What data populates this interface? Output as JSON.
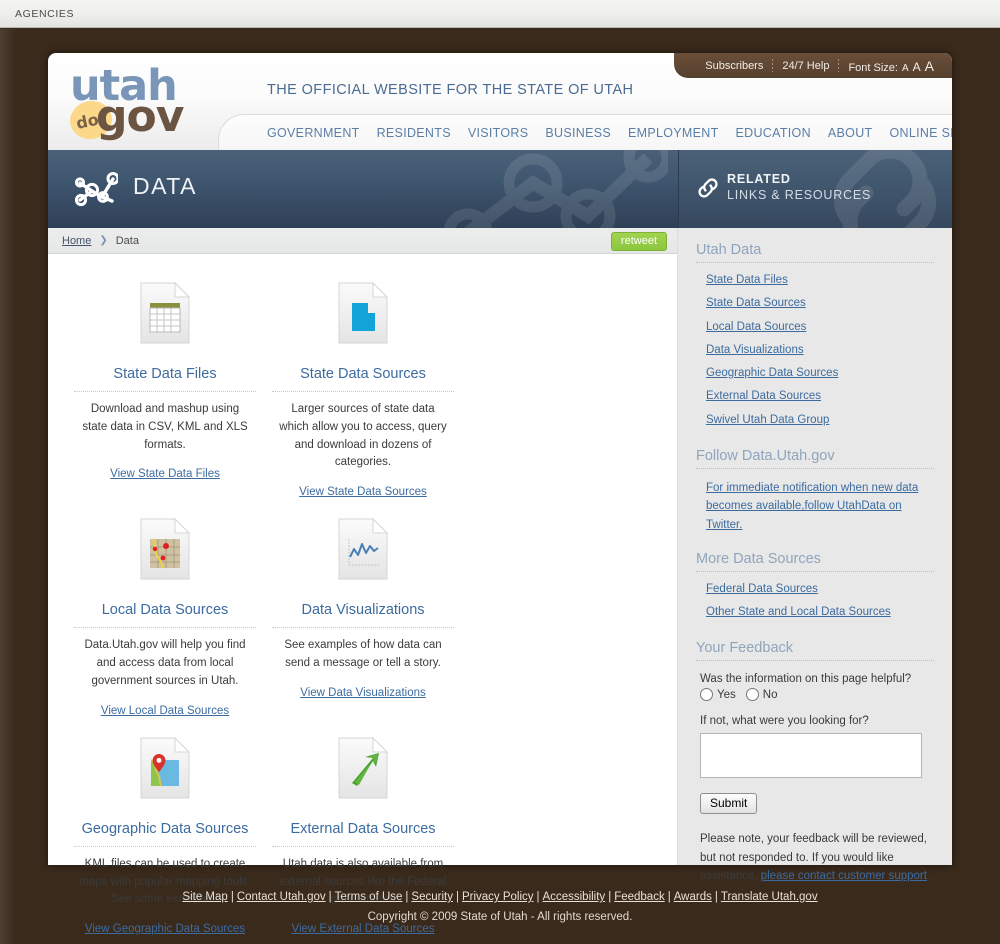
{
  "topbar": {
    "agencies_label": "AGENCIES"
  },
  "utility": {
    "subscribers": "Subscribers",
    "help": "24/7 Help",
    "font_size_label": "Font Size:",
    "font_a_small": "A",
    "font_a_medium": "A",
    "font_a_large": "A"
  },
  "logo": {
    "utah": "utah",
    "dot": "dot",
    "gov": "gov"
  },
  "header": {
    "tagline": "THE OFFICIAL WEBSITE FOR THE STATE OF UTAH",
    "nav": [
      "GOVERNMENT",
      "RESIDENTS",
      "VISITORS",
      "BUSINESS",
      "EMPLOYMENT",
      "EDUCATION",
      "ABOUT",
      "ONLINE SERVICES"
    ]
  },
  "banner": {
    "main_title": "DATA",
    "main_icon": "data-network-icon",
    "side_icon": "link-chain-icon",
    "side_line1": "RELATED",
    "side_line2": "LINKS & RESOURCES"
  },
  "breadcrumb": {
    "home": "Home",
    "arrow": "❯",
    "current": "Data",
    "retweet": "retweet"
  },
  "cards": [
    {
      "icon": "spreadsheet-file-icon",
      "title": "State Data Files",
      "desc": "Download and mashup using state data in CSV, KML and XLS formats.",
      "link": "View State Data Files"
    },
    {
      "icon": "utah-shape-file-icon",
      "title": "State Data Sources",
      "desc": "Larger sources of state data which allow you to access, query and download in dozens of categories.",
      "link": "View State Data Sources"
    },
    {
      "icon": "local-map-file-icon",
      "title": "Local Data Sources",
      "desc": "Data.Utah.gov will help you find and access data from local government sources in Utah.",
      "link": "View Local Data Sources"
    },
    {
      "icon": "line-chart-file-icon",
      "title": "Data Visualizations",
      "desc": "See examples of how data can send a message or tell a story.",
      "link": "View Data Visualizations"
    },
    {
      "icon": "map-pin-file-icon",
      "title": "Geographic Data Sources",
      "desc": "KML files can be used to create maps with popular mapping tools. See some examples.",
      "link": "View Geographic Data Sources"
    },
    {
      "icon": "external-arrow-file-icon",
      "title": "External Data Sources",
      "desc": "Utah data is also available from external sources like the Federal government.",
      "link": "View External Data Sources"
    }
  ],
  "sidebar": {
    "utah_data": {
      "heading": "Utah Data",
      "links": [
        "State Data Files",
        "State Data Sources",
        "Local Data Sources",
        "Data Visualizations",
        "Geographic Data Sources",
        "External Data Sources",
        "Swivel Utah Data Group"
      ]
    },
    "follow": {
      "heading": "Follow Data.Utah.gov",
      "text": "For immediate notification when new data becomes available,follow UtahData on Twitter."
    },
    "more": {
      "heading": "More Data Sources",
      "links": [
        "Federal Data Sources",
        "Other State and Local Data Sources"
      ]
    },
    "feedback": {
      "heading": "Your Feedback",
      "question": "Was the information on this page helpful?",
      "yes": "Yes",
      "no": "No",
      "question2": "If not, what were you looking for?",
      "textarea_value": "",
      "textarea_placeholder": "",
      "submit": "Submit",
      "note_before": "Please note, your feedback will be reviewed, but not responded to. If you would like assistance, ",
      "note_link": "please contact customer support",
      "note_after": "."
    }
  },
  "footer": {
    "links": [
      "Site Map",
      "Contact Utah.gov",
      "Terms of Use",
      "Security",
      "Privacy Policy",
      "Accessibility",
      "Feedback",
      "Awards",
      "Translate Utah.gov"
    ],
    "separator": "|",
    "copyright": "Copyright © 2009 State of Utah - All rights reserved."
  },
  "colors": {
    "frame_brown": "#3a2a1c",
    "banner_blue": "#3f566f",
    "link_blue": "#3c6ba0",
    "accent_green": "#8cc63f",
    "logo_blue": "#7996b8",
    "logo_brown": "#6b5442",
    "logo_yellow": "#fcd88a"
  }
}
